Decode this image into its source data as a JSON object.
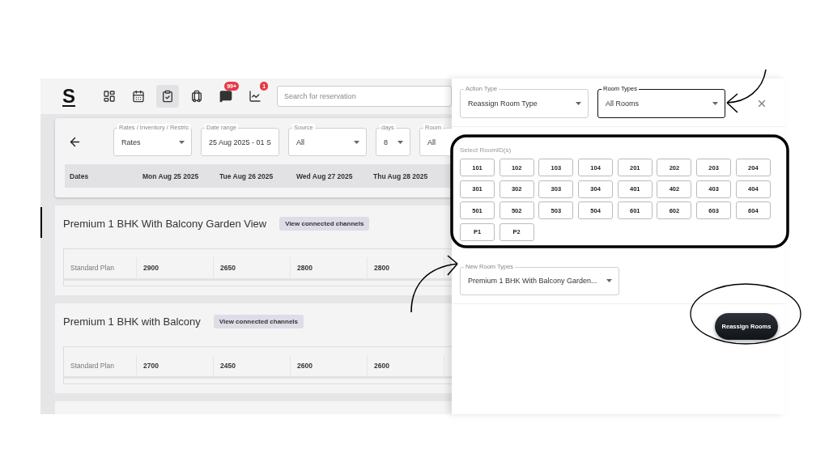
{
  "nav": {
    "logo": "S",
    "icons": [
      {
        "kind": "dashboard",
        "selected": false
      },
      {
        "kind": "calendar",
        "selected": false
      },
      {
        "kind": "clipboard",
        "selected": true
      },
      {
        "kind": "luggage",
        "selected": false
      },
      {
        "kind": "chat",
        "selected": false,
        "badge": "99+"
      },
      {
        "kind": "chart",
        "selected": false,
        "badge": "1"
      }
    ],
    "search": {
      "placeholder": "Search for reservation"
    }
  },
  "filters": {
    "fields": [
      {
        "label": "Rates / Inventory / Restric",
        "value": "Rates",
        "kind": "select"
      },
      {
        "label": "Date range",
        "value": "25 Aug 2025 - 01 S",
        "kind": "text"
      },
      {
        "label": "Source",
        "value": "All",
        "kind": "select"
      },
      {
        "label": "days",
        "value": "8",
        "kind": "select"
      },
      {
        "label": "Room",
        "value": "All",
        "kind": "select"
      }
    ],
    "columns": [
      "Dates",
      "Mon Aug 25 2025",
      "Tue Aug 26 2025",
      "Wed Aug 27 2025",
      "Thu Aug 28 2025"
    ]
  },
  "room_types": [
    {
      "title": "Premium 1 BHK With Balcony Garden View",
      "button": "View connected channels",
      "rows": [
        {
          "plan": "Standard Plan",
          "values": [
            "2900",
            "2650",
            "2800",
            "2800"
          ]
        }
      ]
    },
    {
      "title": "Premium 1 BHK with Balcony",
      "button": "View connected channels",
      "rows": [
        {
          "plan": "Standard Plan",
          "values": [
            "2700",
            "2450",
            "2600",
            "2600"
          ]
        }
      ]
    }
  ],
  "panel": {
    "action_type": {
      "label": "Action Type",
      "value": "Reassign Room Type",
      "focused": false
    },
    "room_types_field": {
      "label": "Room Types",
      "value": "All Rooms",
      "focused": true
    },
    "select_label": "Select RoomID(s)",
    "rooms": [
      {
        "label": "101",
        "selected": false
      },
      {
        "label": "102",
        "selected": false
      },
      {
        "label": "103",
        "selected": false
      },
      {
        "label": "104",
        "selected": false
      },
      {
        "label": "201",
        "selected": false
      },
      {
        "label": "202",
        "selected": false
      },
      {
        "label": "203",
        "selected": false
      },
      {
        "label": "204",
        "selected": false
      },
      {
        "label": "301",
        "selected": false
      },
      {
        "label": "302",
        "selected": false
      },
      {
        "label": "303",
        "selected": false
      },
      {
        "label": "304",
        "selected": false
      },
      {
        "label": "401",
        "selected": false
      },
      {
        "label": "402",
        "selected": false
      },
      {
        "label": "403",
        "selected": false
      },
      {
        "label": "404",
        "selected": false
      },
      {
        "label": "501",
        "selected": false
      },
      {
        "label": "502",
        "selected": false
      },
      {
        "label": "503",
        "selected": false
      },
      {
        "label": "504",
        "selected": false
      },
      {
        "label": "601",
        "selected": false
      },
      {
        "label": "602",
        "selected": false
      },
      {
        "label": "603",
        "selected": false
      },
      {
        "label": "604",
        "selected": false
      },
      {
        "label": "P1",
        "selected": false
      },
      {
        "label": "P2",
        "selected": false
      }
    ],
    "new_room_types": {
      "label": "New Room Types",
      "value": "Premium 1 BHK With Balcony Garden...",
      "focused": false
    },
    "submit": "Reassign Rooms"
  }
}
